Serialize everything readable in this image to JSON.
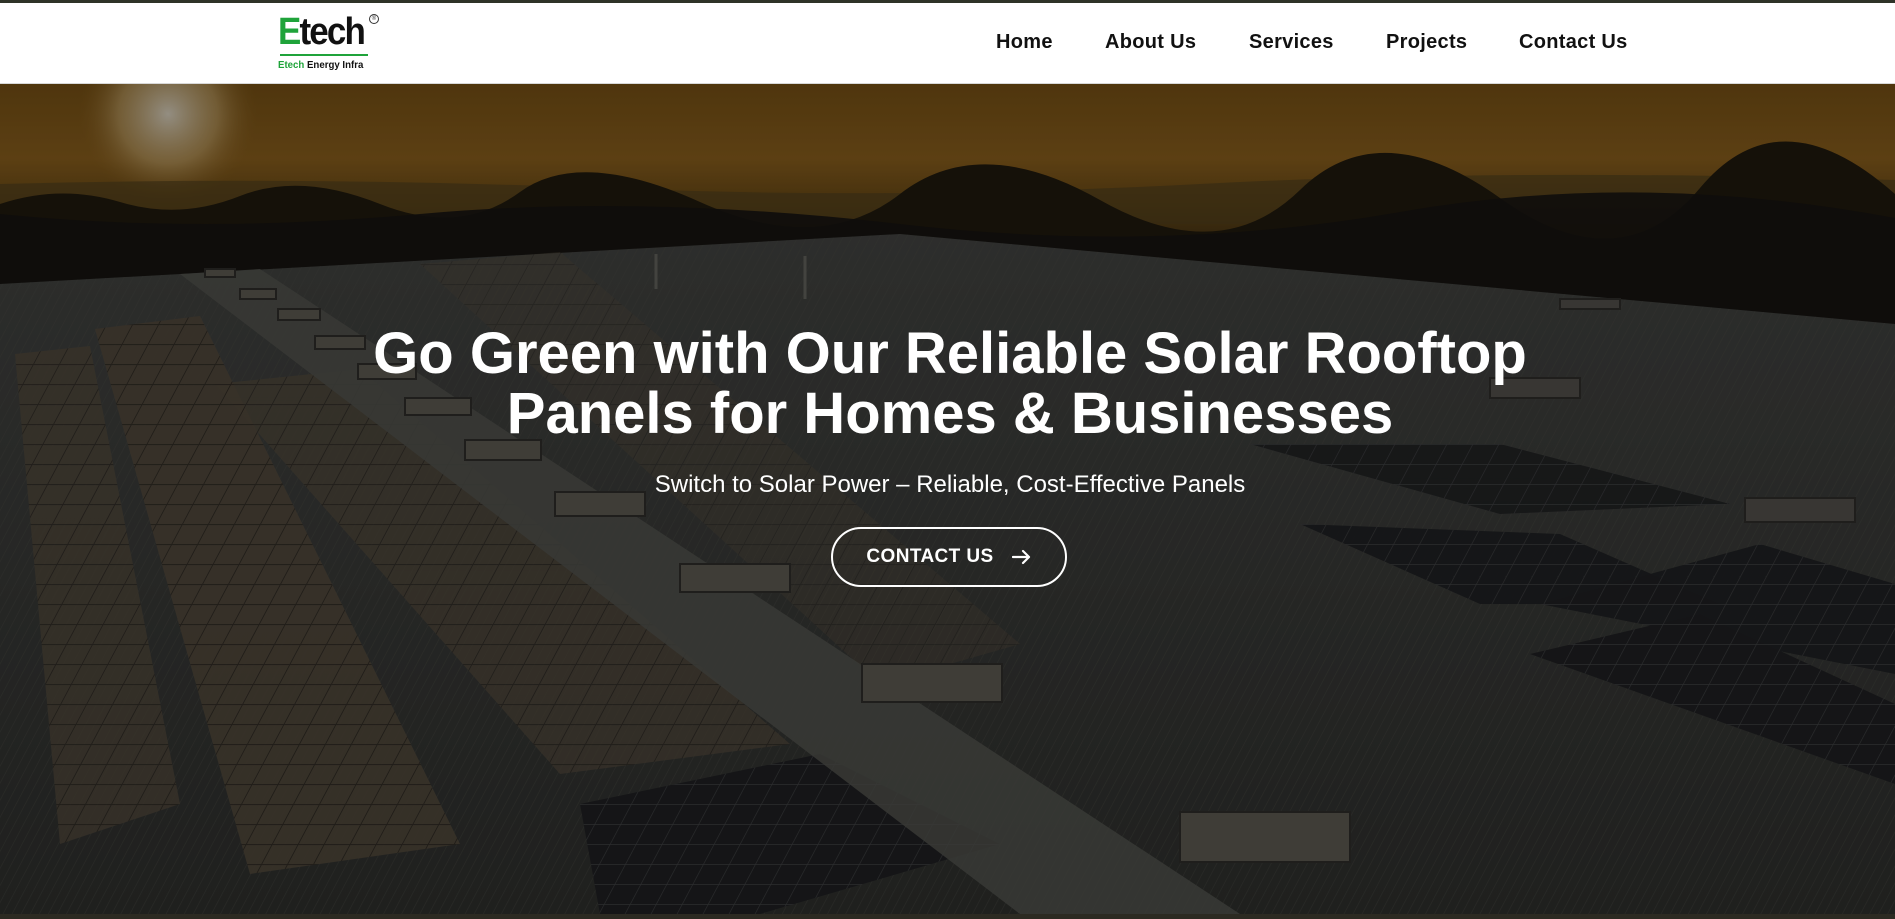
{
  "brand": {
    "logo_word_first": "E",
    "logo_word_rest": "tech",
    "logo_registered": "®",
    "logo_tagline_first": "Etech",
    "logo_tagline_rest": " Energy Infra",
    "accent_color": "#1fa33a"
  },
  "nav": {
    "items": [
      {
        "label": "Home"
      },
      {
        "label": "About Us"
      },
      {
        "label": "Services"
      },
      {
        "label": "Projects"
      },
      {
        "label": "Contact Us"
      }
    ]
  },
  "hero": {
    "headline_line1": "Go Green with Our Reliable Solar Rooftop",
    "headline_line2": "Panels for Homes & Businesses",
    "subline": "Switch to Solar Power – Reliable, Cost-Effective Panels",
    "cta_label": "CONTACT US",
    "cta_icon": "arrow-right-icon",
    "background_image": "solar-rooftop-sunset-photo"
  }
}
